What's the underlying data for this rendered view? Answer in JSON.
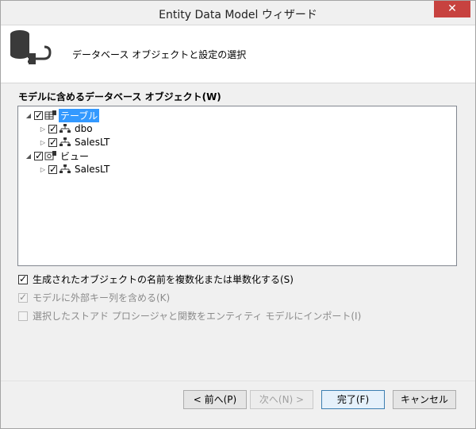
{
  "window": {
    "title": "Entity Data Model ウィザード",
    "close_label": "✕"
  },
  "header": {
    "title": "データベース オブジェクトと設定の選択"
  },
  "objects": {
    "label": "モデルに含めるデータベース オブジェクト(W)",
    "tree": [
      {
        "label": "テーブル",
        "level": 0,
        "expanded": true,
        "checked": true,
        "selected": true,
        "icon": "table-icon"
      },
      {
        "label": "dbo",
        "level": 1,
        "expanded": false,
        "checked": true,
        "selected": false,
        "icon": "schema-icon"
      },
      {
        "label": "SalesLT",
        "level": 1,
        "expanded": false,
        "checked": true,
        "selected": false,
        "icon": "schema-icon"
      },
      {
        "label": "ビュー",
        "level": 0,
        "expanded": true,
        "checked": true,
        "selected": false,
        "icon": "view-icon"
      },
      {
        "label": "SalesLT",
        "level": 1,
        "expanded": false,
        "checked": true,
        "selected": false,
        "icon": "schema-icon"
      }
    ]
  },
  "options": [
    {
      "label": "生成されたオブジェクトの名前を複数化または単数化する(S)",
      "checked": true,
      "enabled": true
    },
    {
      "label": "モデルに外部キー列を含める(K)",
      "checked": true,
      "enabled": false
    },
    {
      "label": "選択したストアド プロシージャと関数をエンティティ モデルにインポート(I)",
      "checked": false,
      "enabled": false
    }
  ],
  "buttons": {
    "back": "< 前へ(P)",
    "next": "次へ(N) >",
    "finish": "完了(F)",
    "cancel": "キャンセル"
  },
  "colors": {
    "selection": "#3399ff",
    "close": "#c7423f"
  }
}
